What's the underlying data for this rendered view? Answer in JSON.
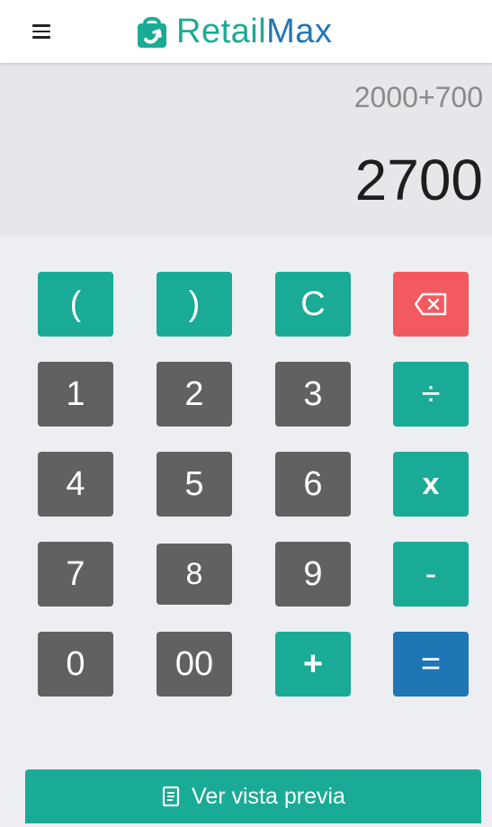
{
  "header": {
    "brand_part1": "Retail",
    "brand_part2": "Max",
    "brand_color1": "#1aab96",
    "brand_color2": "#1f76b5",
    "menu_icon": "hamburger-menu-icon",
    "logo_icon": "shopping-bag-icon"
  },
  "display": {
    "expression": "2000+700",
    "result": "2700"
  },
  "keys": {
    "open_paren": "(",
    "close_paren": ")",
    "clear": "C",
    "backspace_icon": "backspace-icon",
    "one": "1",
    "two": "2",
    "three": "3",
    "divide": "÷",
    "four": "4",
    "five": "5",
    "six": "6",
    "multiply": "x",
    "seven": "7",
    "eight": "8",
    "nine": "9",
    "minus": "-",
    "zero": "0",
    "double_zero": "00",
    "plus": "+",
    "equals": "="
  },
  "footer": {
    "preview_label": "Ver vista previa",
    "preview_icon": "receipt-icon"
  },
  "colors": {
    "teal": "#1aab96",
    "gray": "#616161",
    "red": "#f25a5f",
    "blue": "#1f76b5"
  }
}
